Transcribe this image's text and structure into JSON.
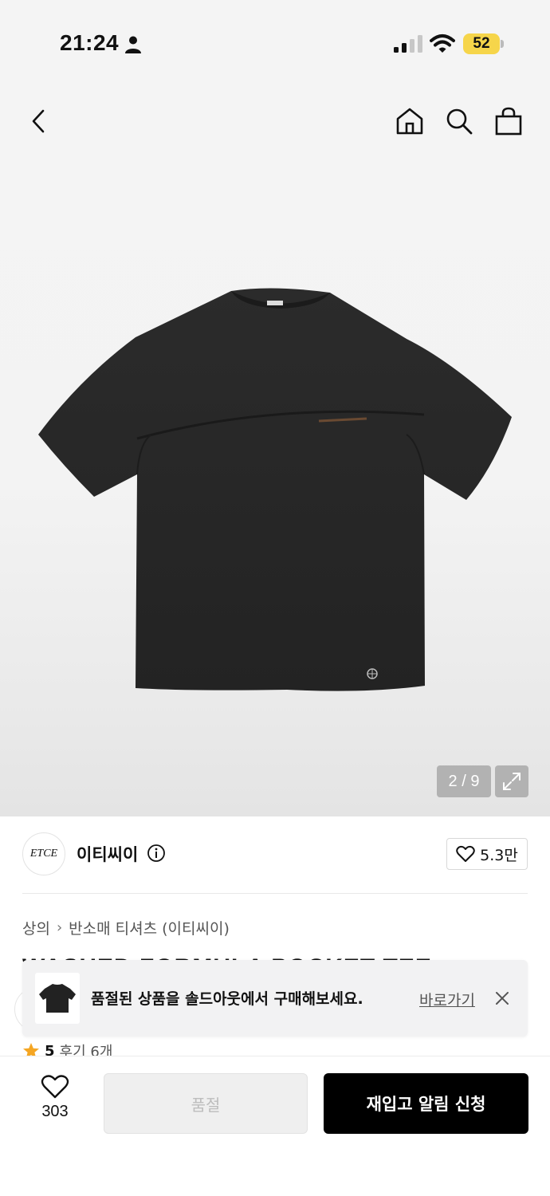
{
  "status_bar": {
    "time": "21:24",
    "battery": "52"
  },
  "header": {
    "back_icon": "chevron-left-icon",
    "home_icon": "home-icon",
    "search_icon": "search-icon",
    "bag_icon": "shopping-bag-icon"
  },
  "gallery": {
    "page_indicator": "2 / 9",
    "current_page": 2,
    "total_pages": 9
  },
  "brand": {
    "logo_text": "ETCE",
    "name": "이티씨이",
    "like_count": "5.3만"
  },
  "breadcrumb": {
    "category": "상의",
    "subcategory": "반소매 티셔츠 (이티씨이)"
  },
  "product": {
    "title": "WASHED FORMULA POCKET TEE (BLACK)"
  },
  "toast": {
    "message": "품절된 상품을 솔드아웃에서 구매해보세요.",
    "link_label": "바로가기"
  },
  "rating": {
    "score": "5",
    "reviews": "후기 6개"
  },
  "bottom_bar": {
    "wish_count": "303",
    "soldout_label": "품절",
    "restock_label": "재입고 알림 신청"
  },
  "colors": {
    "accent_black": "#000000",
    "battery_yellow": "#f6d54a",
    "star_orange": "#f5a623"
  }
}
